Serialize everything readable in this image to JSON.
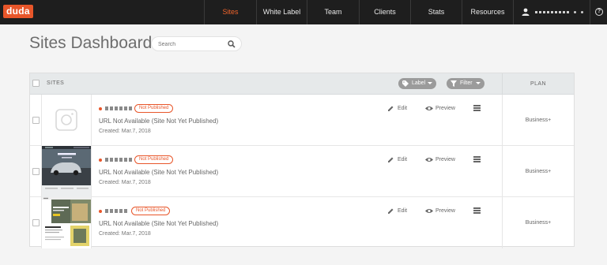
{
  "nav": {
    "logo": "duda",
    "items": [
      {
        "label": "Sites",
        "active": true
      },
      {
        "label": "White Label",
        "active": false
      },
      {
        "label": "Team",
        "active": false
      },
      {
        "label": "Clients",
        "active": false
      },
      {
        "label": "Stats",
        "active": false
      },
      {
        "label": "Resources",
        "active": false
      }
    ],
    "user_icon": "user-icon",
    "help_icon": "help-icon",
    "help_glyph": "?"
  },
  "page": {
    "title": "Sites Dashboard",
    "search_placeholder": "Search"
  },
  "table": {
    "header_sites": "SITES",
    "label_button": "Label",
    "filter_button": "Filter",
    "header_plan": "PLAN",
    "rows": [
      {
        "status": "Not Published",
        "url": "URL Not Available (Site Not Yet Published)",
        "created": "Created: Mar.7, 2018",
        "edit": "Edit",
        "preview": "Preview",
        "plan": "Business+",
        "thumbnail": "placeholder-icon"
      },
      {
        "status": "Not Published",
        "url": "URL Not Available (Site Not Yet Published)",
        "created": "Created: Mar.7, 2018",
        "edit": "Edit",
        "preview": "Preview",
        "plan": "Business+",
        "thumbnail": "car-site-screenshot"
      },
      {
        "status": "Not Published",
        "url": "URL Not Available (Site Not Yet Published)",
        "created": "Created: Mar.7, 2018",
        "edit": "Edit",
        "preview": "Preview",
        "plan": "Business+",
        "thumbnail": "business-site-screenshot"
      }
    ]
  },
  "colors": {
    "accent": "#e8562a",
    "nav_bg": "#1e1e1e",
    "page_bg": "#f4f4f4"
  }
}
